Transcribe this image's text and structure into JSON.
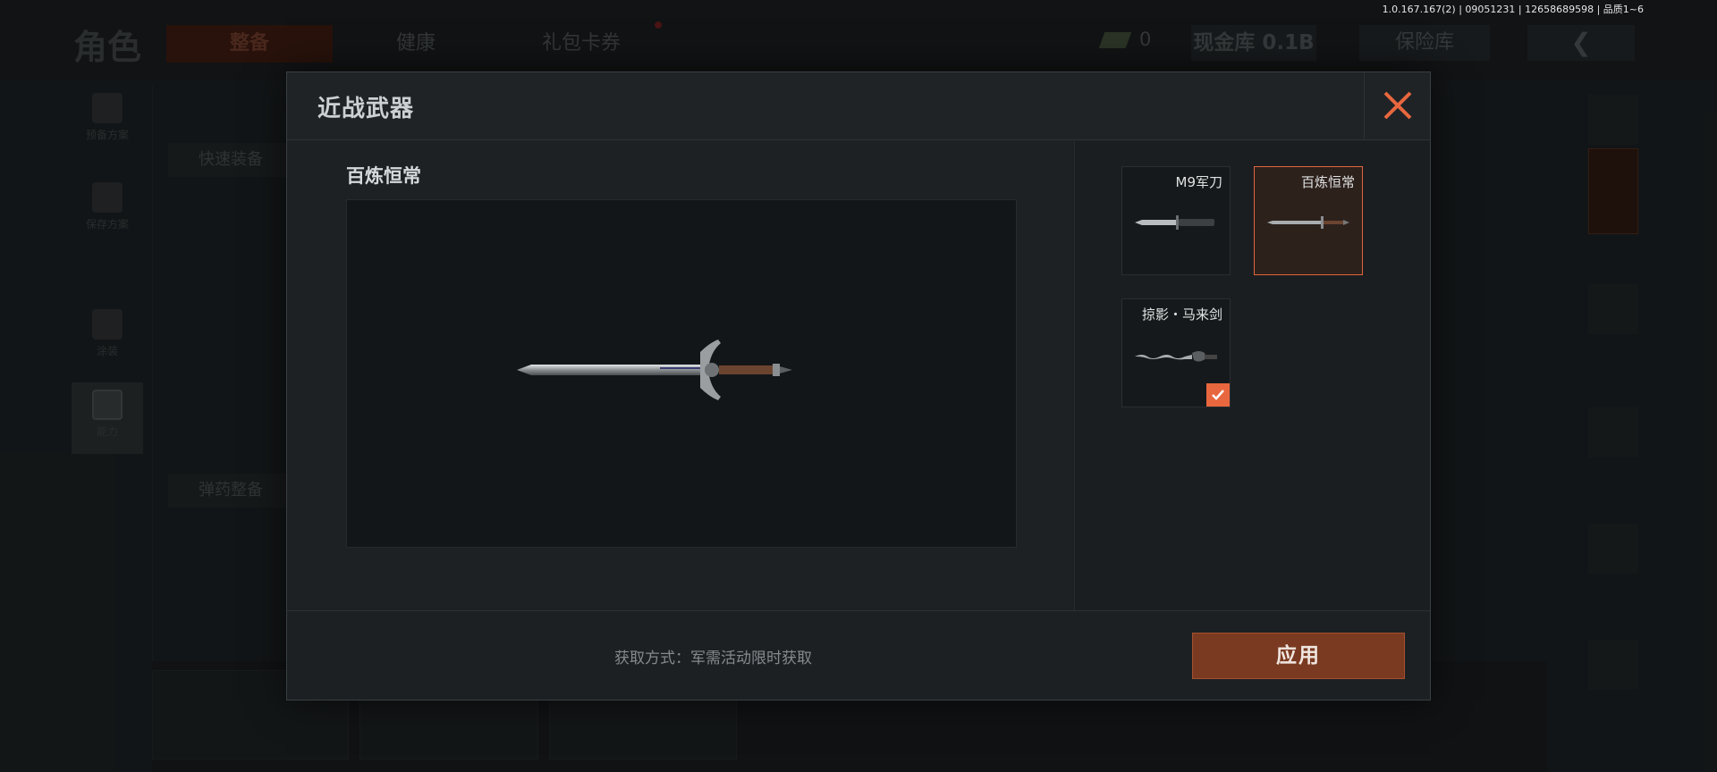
{
  "version_info": "1.0.167.167(2) | 09051231 | 12658689598 | 品质1~6",
  "background": {
    "title": "角色",
    "tabs": [
      {
        "label": "整备",
        "active": true
      },
      {
        "label": "健康",
        "active": false
      },
      {
        "label": "礼包卡券",
        "active": false
      }
    ],
    "cash_count": "0",
    "vault_label": "现金库 0.1B",
    "insurance_label": "保险库",
    "side_items": [
      {
        "label": "预备方案",
        "icon": "vest-icon"
      },
      {
        "label": "保存方案",
        "icon": "download-icon"
      },
      {
        "label": "涂装",
        "icon": "helmet-icon"
      },
      {
        "label": "能力",
        "icon": "bolt-icon"
      }
    ],
    "quick_equip_label": "快速装备",
    "ammo_equip_label": "弹药整备"
  },
  "dialog": {
    "title": "近战武器",
    "preview_name": "百炼恒常",
    "weapons": [
      {
        "name": "M9军刀",
        "icon": "knife-icon",
        "selected": false,
        "equipped": false
      },
      {
        "name": "百炼恒常",
        "icon": "sword-icon",
        "selected": true,
        "equipped": false
      },
      {
        "name": "掠影・马来剑",
        "icon": "kris-icon",
        "selected": false,
        "equipped": true
      }
    ],
    "source_text": "获取方式：军需活动限时获取",
    "apply_label": "应用"
  },
  "colors": {
    "accent": "#e8673e",
    "apply_bg": "#7a3a21"
  }
}
